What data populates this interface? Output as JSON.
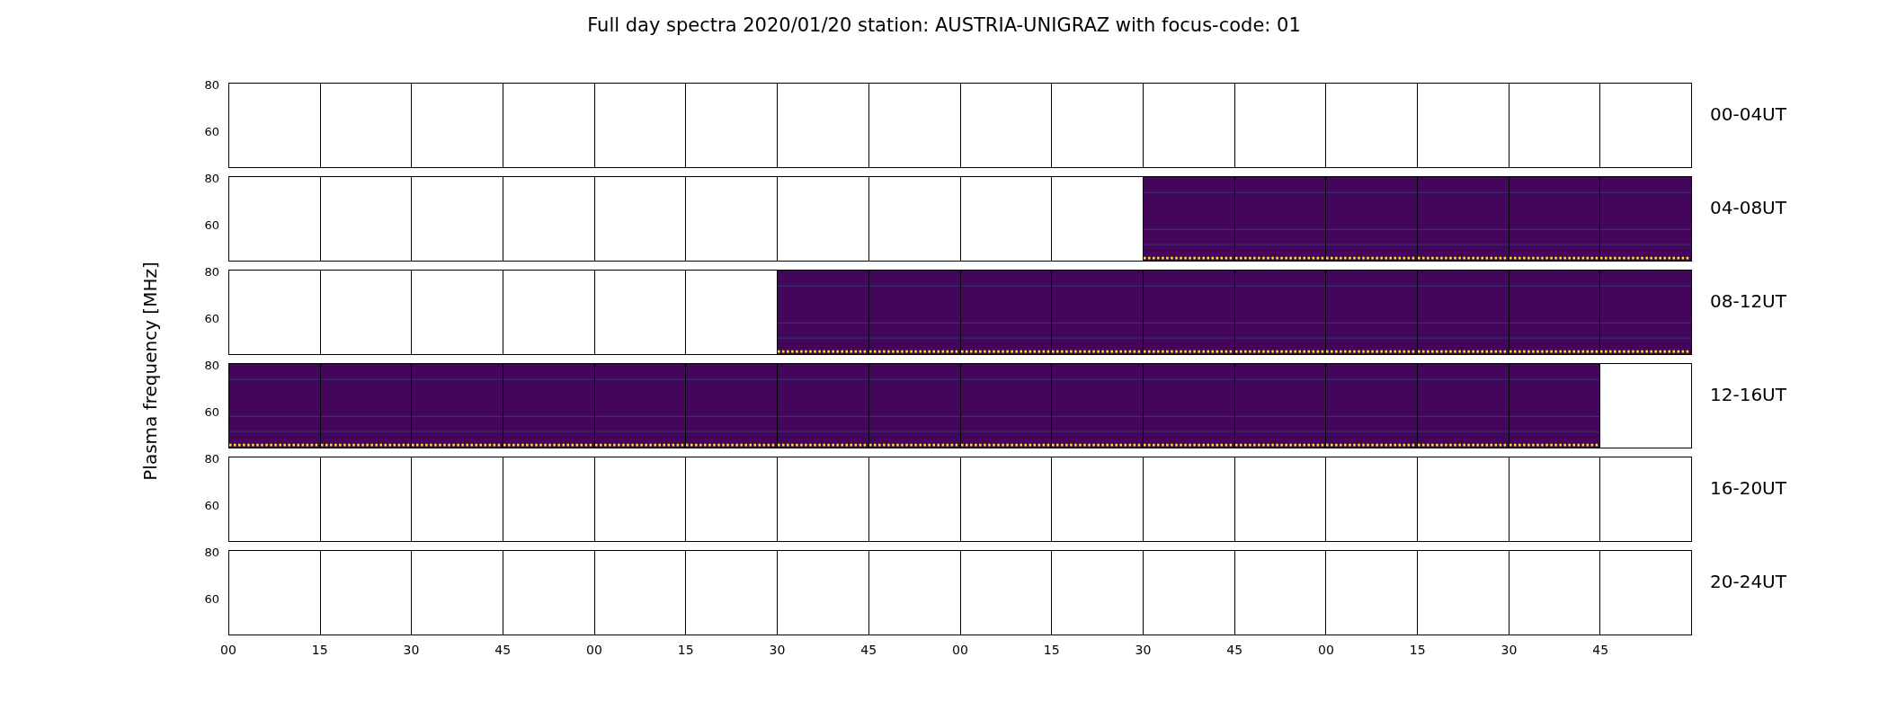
{
  "title": "Full day spectra 2020/01/20 station: AUSTRIA-UNIGRAZ with focus-code: 01",
  "ylabel": "Plasma frequency [MHz]",
  "rows": [
    {
      "label": "00-04UT",
      "yticks": [
        "80",
        "60"
      ],
      "panels": [
        {
          "has_data": false
        },
        {
          "has_data": false
        },
        {
          "has_data": false
        },
        {
          "has_data": false
        },
        {
          "has_data": false
        },
        {
          "has_data": false
        },
        {
          "has_data": false
        },
        {
          "has_data": false
        },
        {
          "has_data": false
        },
        {
          "has_data": false
        },
        {
          "has_data": false
        },
        {
          "has_data": false
        },
        {
          "has_data": false
        },
        {
          "has_data": false
        },
        {
          "has_data": false
        },
        {
          "has_data": false
        }
      ]
    },
    {
      "label": "04-08UT",
      "yticks": [
        "80",
        "60"
      ],
      "panels": [
        {
          "has_data": false
        },
        {
          "has_data": false
        },
        {
          "has_data": false
        },
        {
          "has_data": false
        },
        {
          "has_data": false
        },
        {
          "has_data": false
        },
        {
          "has_data": false
        },
        {
          "has_data": false
        },
        {
          "has_data": false
        },
        {
          "has_data": false
        },
        {
          "has_data": true
        },
        {
          "has_data": true
        },
        {
          "has_data": true
        },
        {
          "has_data": true
        },
        {
          "has_data": true
        },
        {
          "has_data": true
        }
      ]
    },
    {
      "label": "08-12UT",
      "yticks": [
        "80",
        "60"
      ],
      "panels": [
        {
          "has_data": false
        },
        {
          "has_data": false
        },
        {
          "has_data": false
        },
        {
          "has_data": false
        },
        {
          "has_data": false
        },
        {
          "has_data": false
        },
        {
          "has_data": true
        },
        {
          "has_data": true
        },
        {
          "has_data": true
        },
        {
          "has_data": true
        },
        {
          "has_data": true
        },
        {
          "has_data": true
        },
        {
          "has_data": true
        },
        {
          "has_data": true
        },
        {
          "has_data": true
        },
        {
          "has_data": true
        }
      ]
    },
    {
      "label": "12-16UT",
      "yticks": [
        "80",
        "60"
      ],
      "panels": [
        {
          "has_data": true
        },
        {
          "has_data": true
        },
        {
          "has_data": true
        },
        {
          "has_data": true
        },
        {
          "has_data": true
        },
        {
          "has_data": true
        },
        {
          "has_data": true
        },
        {
          "has_data": true
        },
        {
          "has_data": true
        },
        {
          "has_data": true
        },
        {
          "has_data": true
        },
        {
          "has_data": true
        },
        {
          "has_data": true
        },
        {
          "has_data": true
        },
        {
          "has_data": true
        },
        {
          "has_data": false
        }
      ]
    },
    {
      "label": "16-20UT",
      "yticks": [
        "80",
        "60"
      ],
      "panels": [
        {
          "has_data": false
        },
        {
          "has_data": false
        },
        {
          "has_data": false
        },
        {
          "has_data": false
        },
        {
          "has_data": false
        },
        {
          "has_data": false
        },
        {
          "has_data": false
        },
        {
          "has_data": false
        },
        {
          "has_data": false
        },
        {
          "has_data": false
        },
        {
          "has_data": false
        },
        {
          "has_data": false
        },
        {
          "has_data": false
        },
        {
          "has_data": false
        },
        {
          "has_data": false
        },
        {
          "has_data": false
        }
      ]
    },
    {
      "label": "20-24UT",
      "yticks": [
        "80",
        "60"
      ],
      "panels": [
        {
          "has_data": false
        },
        {
          "has_data": false
        },
        {
          "has_data": false
        },
        {
          "has_data": false
        },
        {
          "has_data": false
        },
        {
          "has_data": false
        },
        {
          "has_data": false
        },
        {
          "has_data": false
        },
        {
          "has_data": false
        },
        {
          "has_data": false
        },
        {
          "has_data": false
        },
        {
          "has_data": false
        },
        {
          "has_data": false
        },
        {
          "has_data": false
        },
        {
          "has_data": false
        },
        {
          "has_data": false
        }
      ]
    }
  ],
  "xticks": [
    "00",
    "15",
    "30",
    "45",
    "00",
    "15",
    "30",
    "45",
    "00",
    "15",
    "30",
    "45",
    "00",
    "15",
    "30",
    "45"
  ]
}
